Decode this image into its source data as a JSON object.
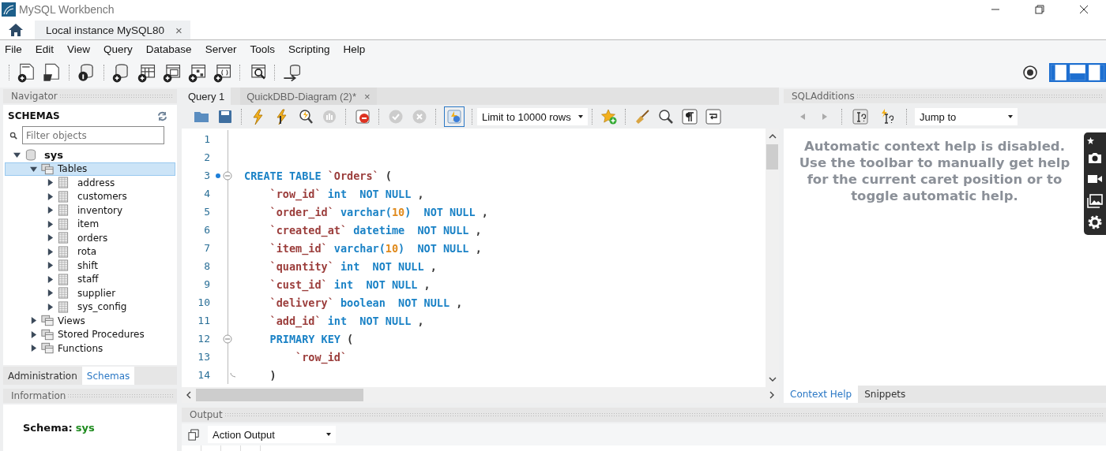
{
  "window": {
    "title": "MySQL Workbench"
  },
  "connection_tabs": [
    {
      "label": "Local instance MySQL80",
      "selected": true,
      "close": "×"
    }
  ],
  "menu": [
    "File",
    "Edit",
    "View",
    "Query",
    "Database",
    "Server",
    "Tools",
    "Scripting",
    "Help"
  ],
  "navigator": {
    "title": "Navigator",
    "section": "SCHEMAS",
    "filter": {
      "placeholder": "Filter objects"
    },
    "tree": [
      {
        "label": "sys",
        "kind": "schema",
        "expanded": true,
        "selected": false,
        "children": [
          {
            "label": "Tables",
            "kind": "folder",
            "expanded": true,
            "selected": true,
            "children": [
              {
                "label": "address",
                "kind": "table",
                "expanded": false,
                "selected": false
              },
              {
                "label": "customers",
                "kind": "table",
                "expanded": false,
                "selected": false
              },
              {
                "label": "inventory",
                "kind": "table",
                "expanded": false,
                "selected": false
              },
              {
                "label": "item",
                "kind": "table",
                "expanded": false,
                "selected": false
              },
              {
                "label": "orders",
                "kind": "table",
                "expanded": false,
                "selected": false
              },
              {
                "label": "rota",
                "kind": "table",
                "expanded": false,
                "selected": false
              },
              {
                "label": "shift",
                "kind": "table",
                "expanded": false,
                "selected": false
              },
              {
                "label": "staff",
                "kind": "table",
                "expanded": false,
                "selected": false
              },
              {
                "label": "supplier",
                "kind": "table",
                "expanded": false,
                "selected": false
              },
              {
                "label": "sys_config",
                "kind": "table",
                "expanded": false,
                "selected": false
              }
            ]
          },
          {
            "label": "Views",
            "kind": "folder",
            "expanded": false,
            "selected": false
          },
          {
            "label": "Stored Procedures",
            "kind": "folder",
            "expanded": false,
            "selected": false
          },
          {
            "label": "Functions",
            "kind": "folder",
            "expanded": false,
            "selected": false
          }
        ]
      }
    ],
    "tabs": [
      {
        "label": "Administration",
        "selected": false
      },
      {
        "label": "Schemas",
        "selected": true
      }
    ]
  },
  "information": {
    "title": "Information",
    "label": "Schema:",
    "value": "sys"
  },
  "editor": {
    "tabs": [
      {
        "label": "Query 1",
        "selected": true
      },
      {
        "label": "QuickDBD-Diagram (2)*",
        "selected": false,
        "close": "×"
      }
    ],
    "autocommit_on": true,
    "limit": {
      "value": "Limit to 10000 rows"
    },
    "lines": [
      {
        "number": "1",
        "bookmark": false,
        "fold_open": false,
        "fold_close": false
      },
      {
        "number": "2",
        "bookmark": false,
        "fold_open": false,
        "fold_close": false
      },
      {
        "number": "3",
        "bookmark": true,
        "fold_open": true,
        "fold_close": false,
        "tokens": [
          {
            "kind": "keyword",
            "text": "CREATE TABLE "
          },
          {
            "kind": "identifier",
            "text": "`Orders`"
          },
          {
            "kind": "plain",
            "text": " ("
          }
        ]
      },
      {
        "number": "4",
        "bookmark": false,
        "fold_open": false,
        "fold_close": false,
        "tokens": [
          {
            "kind": "identifier",
            "text": "    `row_id`"
          },
          {
            "kind": "keyword",
            "text": " int  NOT NULL "
          },
          {
            "kind": "plain",
            "text": ","
          }
        ]
      },
      {
        "number": "5",
        "bookmark": false,
        "fold_open": false,
        "fold_close": false,
        "tokens": [
          {
            "kind": "identifier",
            "text": "    `order_id`"
          },
          {
            "kind": "keyword",
            "text": " varchar("
          },
          {
            "kind": "number",
            "text": "10"
          },
          {
            "kind": "keyword",
            "text": ")  NOT NULL "
          },
          {
            "kind": "plain",
            "text": ","
          }
        ]
      },
      {
        "number": "6",
        "bookmark": false,
        "fold_open": false,
        "fold_close": false,
        "tokens": [
          {
            "kind": "identifier",
            "text": "    `created_at`"
          },
          {
            "kind": "keyword",
            "text": " datetime  NOT NULL "
          },
          {
            "kind": "plain",
            "text": ","
          }
        ]
      },
      {
        "number": "7",
        "bookmark": false,
        "fold_open": false,
        "fold_close": false,
        "tokens": [
          {
            "kind": "identifier",
            "text": "    `item_id`"
          },
          {
            "kind": "keyword",
            "text": " varchar("
          },
          {
            "kind": "number",
            "text": "10"
          },
          {
            "kind": "keyword",
            "text": ")  NOT NULL "
          },
          {
            "kind": "plain",
            "text": ","
          }
        ]
      },
      {
        "number": "8",
        "bookmark": false,
        "fold_open": false,
        "fold_close": false,
        "tokens": [
          {
            "kind": "identifier",
            "text": "    `quantity`"
          },
          {
            "kind": "keyword",
            "text": " int  NOT NULL "
          },
          {
            "kind": "plain",
            "text": ","
          }
        ]
      },
      {
        "number": "9",
        "bookmark": false,
        "fold_open": false,
        "fold_close": false,
        "tokens": [
          {
            "kind": "identifier",
            "text": "    `cust_id`"
          },
          {
            "kind": "keyword",
            "text": " int  NOT NULL "
          },
          {
            "kind": "plain",
            "text": ","
          }
        ]
      },
      {
        "number": "10",
        "bookmark": false,
        "fold_open": false,
        "fold_close": false,
        "tokens": [
          {
            "kind": "identifier",
            "text": "    `delivery`"
          },
          {
            "kind": "keyword",
            "text": " boolean  NOT NULL "
          },
          {
            "kind": "plain",
            "text": ","
          }
        ]
      },
      {
        "number": "11",
        "bookmark": false,
        "fold_open": false,
        "fold_close": false,
        "tokens": [
          {
            "kind": "identifier",
            "text": "    `add_id`"
          },
          {
            "kind": "keyword",
            "text": " int  NOT NULL "
          },
          {
            "kind": "plain",
            "text": ","
          }
        ]
      },
      {
        "number": "12",
        "bookmark": false,
        "fold_open": true,
        "fold_close": false,
        "tokens": [
          {
            "kind": "keyword",
            "text": "    PRIMARY KEY "
          },
          {
            "kind": "plain",
            "text": "("
          }
        ]
      },
      {
        "number": "13",
        "bookmark": false,
        "fold_open": false,
        "fold_close": false,
        "tokens": [
          {
            "kind": "identifier",
            "text": "        `row_id`"
          }
        ]
      },
      {
        "number": "14",
        "bookmark": false,
        "fold_open": false,
        "fold_close": true,
        "tokens": [
          {
            "kind": "plain",
            "text": "    )"
          }
        ]
      }
    ]
  },
  "sql_additions": {
    "title": "SQLAdditions",
    "jump": {
      "value": "Jump to"
    },
    "help_text": "Automatic context help is disabled. Use the toolbar to manually get help for the current caret position or to toggle automatic help.",
    "tabs": [
      {
        "label": "Context Help",
        "selected": true
      },
      {
        "label": "Snippets",
        "selected": false
      }
    ]
  },
  "output": {
    "title": "Output",
    "mode": {
      "value": "Action Output"
    }
  }
}
